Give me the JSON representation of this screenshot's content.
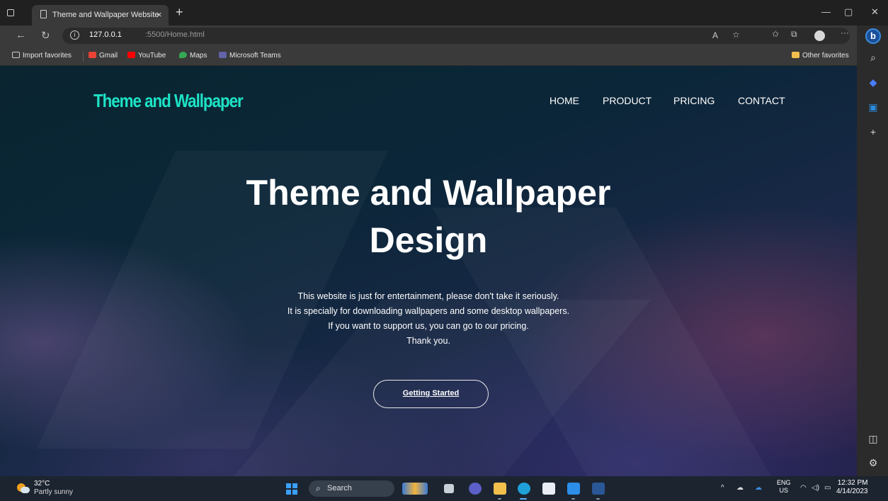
{
  "browser": {
    "tab_title": "Theme and Wallpaper Website",
    "tab_close": "×",
    "new_tab": "+",
    "url_host": "127.0.0.1",
    "url_path": ":5500/Home.html",
    "window_controls": {
      "minimize": "—",
      "restore": "▢",
      "close": "✕"
    },
    "toolbar_icons": [
      "read-aloud-icon",
      "add-favorite-icon",
      "favorites-icon",
      "collections-icon",
      "profile-icon",
      "more-icon"
    ]
  },
  "favorites": {
    "items": [
      {
        "label": "Import favorites",
        "icon": "import-icon",
        "color": "#cfcfcf"
      },
      {
        "label": "Gmail",
        "icon": "gmail-icon",
        "color": "#ea4335"
      },
      {
        "label": "YouTube",
        "icon": "youtube-icon",
        "color": "#ff0000"
      },
      {
        "label": "Maps",
        "icon": "maps-icon",
        "color": "#34a853"
      },
      {
        "label": "Microsoft Teams",
        "icon": "teams-icon",
        "color": "#6264a7"
      }
    ],
    "other": {
      "label": "Other favorites",
      "icon": "folder-icon",
      "color": "#f2c04b"
    }
  },
  "page": {
    "logo": "Theme and Wallpaper",
    "nav": [
      "HOME",
      "PRODUCT",
      "PRICING",
      "CONTACT"
    ],
    "hero_title_line1": "Theme and Wallpaper",
    "hero_title_line2": "Design",
    "hero_lines": [
      "This website is just for entertainment, please don't take it seriously.",
      "It is specially for downloading wallpapers and some desktop wallpapers.",
      "If you want to support us, you can go to our pricing.",
      "Thank you."
    ],
    "cta": "Getting Started",
    "accent_color": "#1de3c6"
  },
  "taskbar": {
    "temp": "32°C",
    "weather": "Partly sunny",
    "search": "Search",
    "lang_top": "ENG",
    "lang_bottom": "US",
    "time": "12:32 PM",
    "date": "4/14/2023"
  }
}
